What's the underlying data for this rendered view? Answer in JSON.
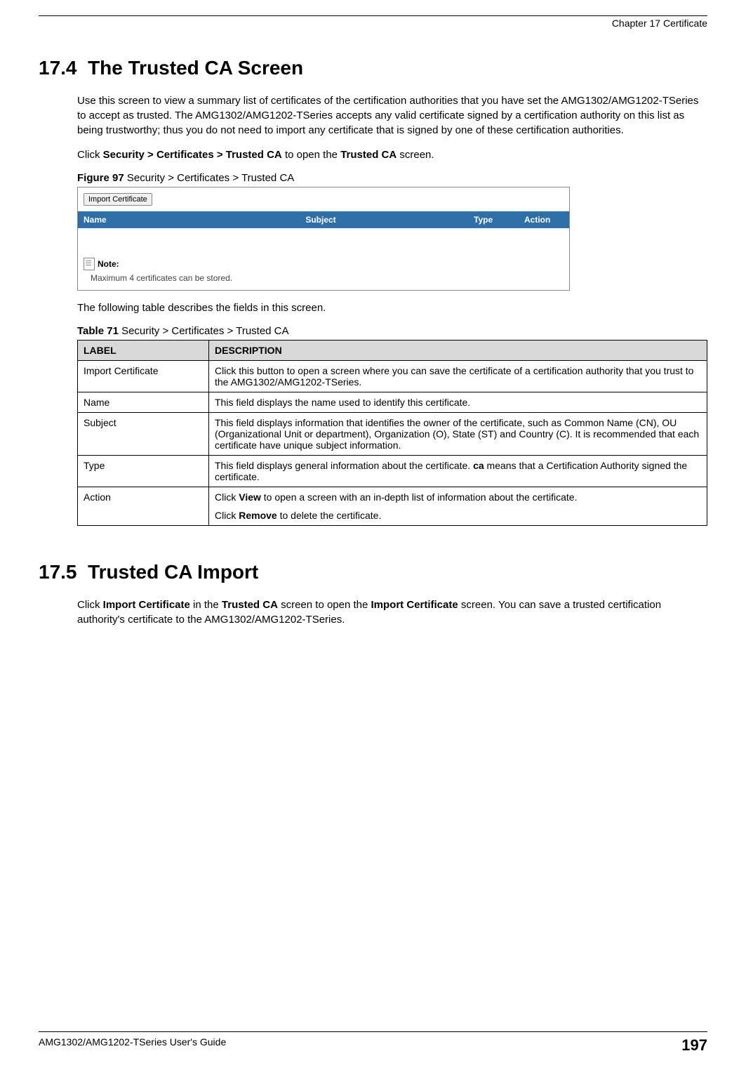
{
  "header": {
    "chapter": "Chapter 17 Certificate"
  },
  "section1": {
    "number": "17.4",
    "title": "The Trusted CA Screen",
    "para1_pre": "Use this screen to view a summary list of certificates of the certification authorities that you have set the AMG1302/AMG1202-TSeries to accept as trusted. The AMG1302/AMG1202-TSeries accepts any valid certificate signed by a certification authority on this list as being trustworthy; thus you do not need to import any certificate that is signed by one of these certification authorities.",
    "para2_pre": "Click ",
    "para2_bold": "Security > Certificates > Trusted CA",
    "para2_mid": " to open the ",
    "para2_bold2": "Trusted CA",
    "para2_post": " screen.",
    "figure_num": "Figure 97",
    "figure_title": "   Security > Certificates > Trusted CA",
    "para3": "The following table describes the fields in this screen.",
    "table_num": "Table 71",
    "table_title": "   Security > Certificates > Trusted CA"
  },
  "screenshot": {
    "import_button": "Import Certificate",
    "cols": {
      "name": "Name",
      "subject": "Subject",
      "type": "Type",
      "action": "Action"
    },
    "note_label": "Note:",
    "note_text": "Maximum 4 certificates can be stored."
  },
  "table_header": {
    "label": "LABEL",
    "desc": "DESCRIPTION"
  },
  "rows": {
    "r0": {
      "label": "Import Certificate",
      "desc": "Click this button to open a screen where you can save the certificate of a certification authority that you trust to the AMG1302/AMG1202-TSeries."
    },
    "r1": {
      "label": "Name",
      "desc": "This field displays the name used to identify this certificate."
    },
    "r2": {
      "label": "Subject",
      "desc": "This field displays information that identifies the owner of the certificate, such as Common Name (CN), OU (Organizational Unit or department), Organization (O), State (ST) and Country (C). It is recommended that each certificate have unique subject information."
    },
    "r3": {
      "label": "Type",
      "desc_pre": "This field displays general information about the certificate. ",
      "desc_bold": "ca",
      "desc_post": " means that a Certification Authority signed the certificate."
    },
    "r4": {
      "label": "Action",
      "p1_pre": "Click ",
      "p1_bold": "View",
      "p1_post": " to open a screen with an in-depth list of information about the certificate.",
      "p2_pre": "Click ",
      "p2_bold": "Remove",
      "p2_post": " to delete the certificate."
    }
  },
  "section2": {
    "number": "17.5",
    "title": "Trusted CA Import",
    "para_pre": "Click ",
    "para_b1": "Import Certificate",
    "para_mid1": " in the ",
    "para_b2": "Trusted CA",
    "para_mid2": " screen to open the ",
    "para_b3": "Import Certificate",
    "para_post": " screen. You can save a trusted certification authority's certificate to the AMG1302/AMG1202-TSeries."
  },
  "footer": {
    "guide": "AMG1302/AMG1202-TSeries User's Guide",
    "page": "197"
  }
}
